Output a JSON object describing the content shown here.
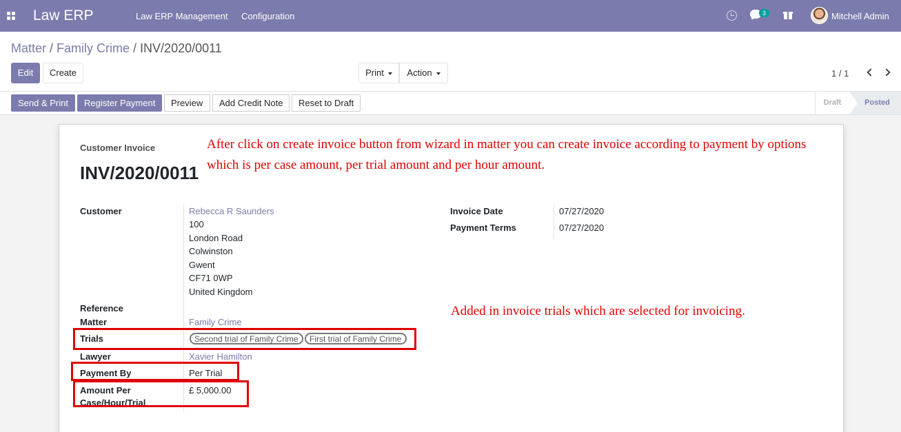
{
  "navbar": {
    "brand": "Law ERP",
    "menus": [
      "Law ERP Management",
      "Configuration"
    ],
    "messages_count": "3",
    "user_name": "Mitchell Admin"
  },
  "breadcrumb": {
    "items": [
      "Matter",
      "Family Crime"
    ],
    "current": "INV/2020/0011"
  },
  "buttons": {
    "edit": "Edit",
    "create": "Create",
    "print": "Print",
    "action": "Action"
  },
  "pager": {
    "value": "1 / 1"
  },
  "statusbar": {
    "buttons": [
      "Send & Print",
      "Register Payment",
      "Preview",
      "Add Credit Note",
      "Reset to Draft"
    ],
    "stages": [
      "Draft",
      "Posted"
    ],
    "current_stage": "Posted"
  },
  "invoice": {
    "doc_type": "Customer Invoice",
    "number": "INV/2020/0011",
    "labels": {
      "customer": "Customer",
      "invoice_date": "Invoice Date",
      "payment_terms": "Payment Terms",
      "reference": "Reference",
      "matter": "Matter",
      "trials": "Trials",
      "lawyer": "Lawyer",
      "payment_by": "Payment By",
      "amount_per_line1": "Amount Per",
      "amount_per_line2": "Case/Hour/Trial"
    },
    "customer_name": "Rebecca R Saunders",
    "address": [
      "100",
      "London Road",
      "Colwinston",
      "Gwent",
      "CF71 0WP",
      "United Kingdom"
    ],
    "invoice_date": "07/27/2020",
    "payment_terms": "07/27/2020",
    "matter": "Family Crime",
    "trials": [
      "Second trial of Family Crime",
      "First trial of Family Crime"
    ],
    "lawyer": "Xavier Hamilton",
    "payment_by": "Per Trial",
    "amount": "£ 5,000.00"
  },
  "annotations": {
    "note1_line1": "After click on create invoice button from wizard in matter you can create invoice according to payment by options",
    "note1_line2": "which is per case amount, per trial amount and per hour amount.",
    "note2": "Added in invoice trials which are selected for invoicing."
  },
  "colors": {
    "brand": "#7c7bad",
    "annotation": "#e10000"
  }
}
